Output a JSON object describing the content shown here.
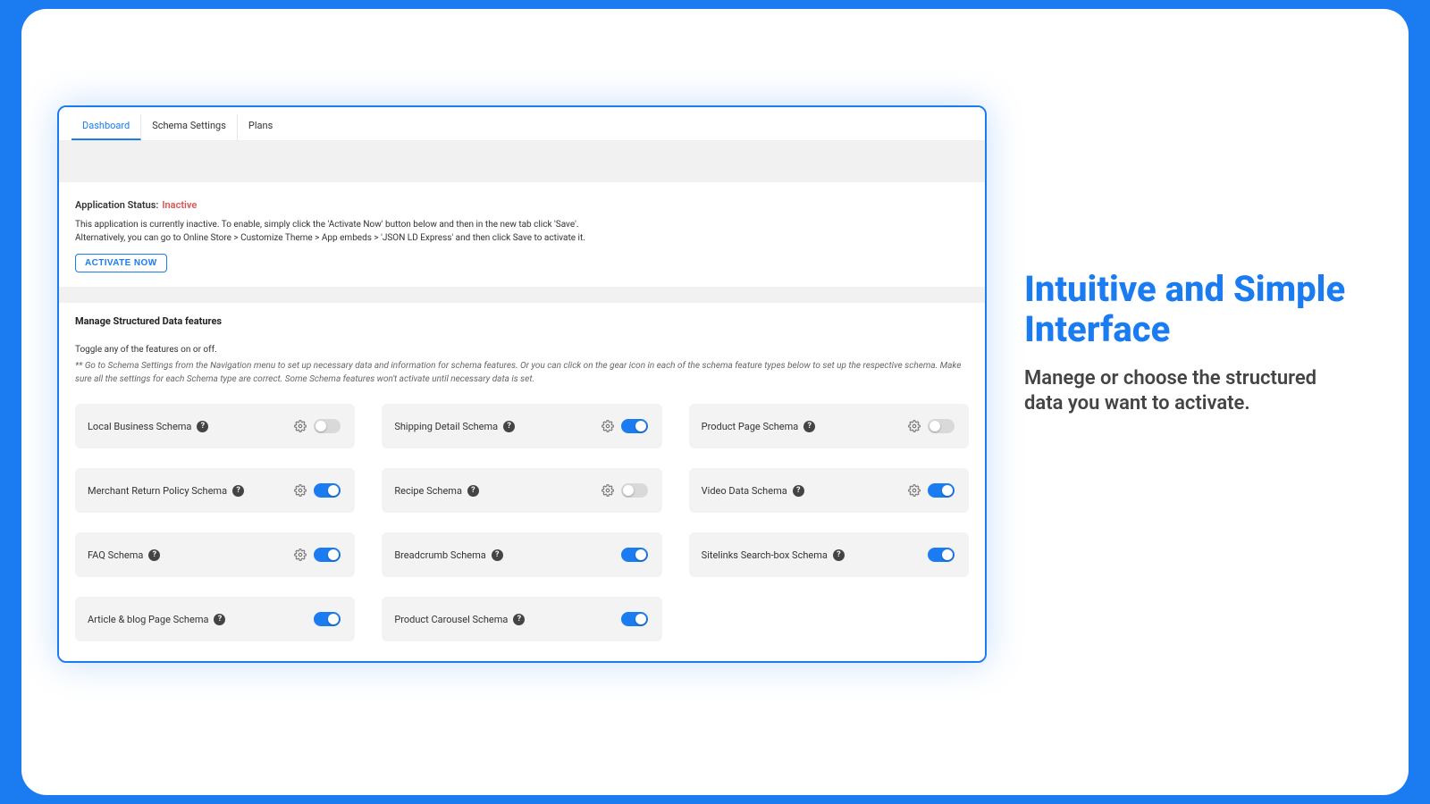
{
  "tabs": {
    "items": [
      {
        "label": "Dashboard",
        "active": true
      },
      {
        "label": "Schema Settings",
        "active": false
      },
      {
        "label": "Plans",
        "active": false
      }
    ]
  },
  "status": {
    "label": "Application Status:",
    "value": "Inactive",
    "line1": "This application is currently inactive. To enable, simply click the 'Activate Now' button below and then in the new tab click 'Save'.",
    "line2": "Alternatively, you can go to Online Store > Customize Theme > App embeds > 'JSON LD Express' and then click Save to activate it.",
    "button": "ACTIVATE NOW"
  },
  "features": {
    "title": "Manage Structured Data features",
    "subtitle": "Toggle any of the features on or off.",
    "note": "** Go to Schema Settings from the Navigation menu to set up necessary data and information for schema features. Or you can click on the gear icon in each of the schema feature types below to set up the respective schema. Make sure all the settings for each Schema type are correct. Some Schema features won't activate until necessary data is set.",
    "cards": [
      {
        "label": "Local Business Schema",
        "gear": true,
        "on": false
      },
      {
        "label": "Shipping Detail Schema",
        "gear": true,
        "on": true
      },
      {
        "label": "Product Page Schema",
        "gear": true,
        "on": false
      },
      {
        "label": "Merchant Return Policy Schema",
        "gear": true,
        "on": true
      },
      {
        "label": "Recipe Schema",
        "gear": true,
        "on": false
      },
      {
        "label": "Video Data Schema",
        "gear": true,
        "on": true
      },
      {
        "label": "FAQ Schema",
        "gear": true,
        "on": true
      },
      {
        "label": "Breadcrumb Schema",
        "gear": false,
        "on": true
      },
      {
        "label": "Sitelinks Search-box Schema",
        "gear": false,
        "on": true
      },
      {
        "label": "Article & blog Page Schema",
        "gear": false,
        "on": true
      },
      {
        "label": "Product Carousel Schema",
        "gear": false,
        "on": true
      }
    ]
  },
  "marketing": {
    "headline": "Intuitive and Simple Interface",
    "body": "Manege or choose the structured data you want to activate."
  }
}
